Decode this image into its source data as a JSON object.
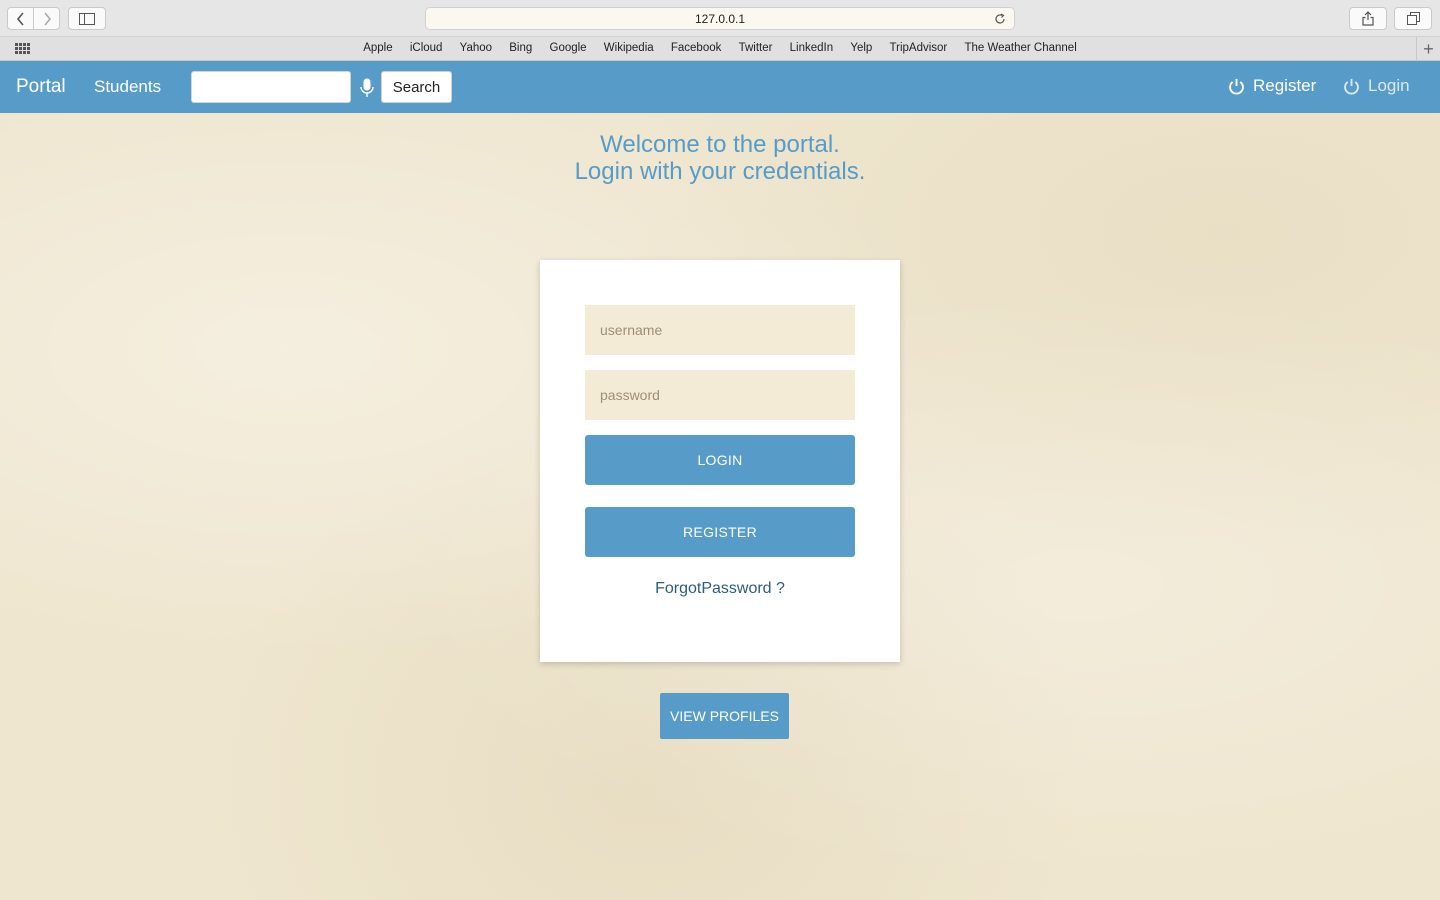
{
  "browser": {
    "url": "127.0.0.1",
    "favorites": [
      "Apple",
      "iCloud",
      "Yahoo",
      "Bing",
      "Google",
      "Wikipedia",
      "Facebook",
      "Twitter",
      "LinkedIn",
      "Yelp",
      "TripAdvisor",
      "The Weather Channel"
    ]
  },
  "navbar": {
    "brand": "Portal",
    "students": "Students",
    "search_value": "",
    "search_button": "Search",
    "register": "Register",
    "login": "Login"
  },
  "welcome": {
    "line1": "Welcome to the portal.",
    "line2": "Login with your credentials."
  },
  "login_form": {
    "username_placeholder": "username",
    "password_placeholder": "password",
    "login_button": "LOGIN",
    "register_button": "REGISTER",
    "forgot_link": "ForgotPassword ?"
  },
  "view_profiles_button": "VIEW PROFILES",
  "colors": {
    "primary": "#579cc8",
    "field_bg": "#f4ebd6",
    "page_bg": "#efe6cf",
    "link": "#2e5d7a"
  },
  "icons": [
    "back-icon",
    "forward-icon",
    "sidebar-icon",
    "reload-icon",
    "share-icon",
    "tabs-icon",
    "apps-grid-icon",
    "add-favorite-icon",
    "microphone-icon",
    "power-icon"
  ]
}
